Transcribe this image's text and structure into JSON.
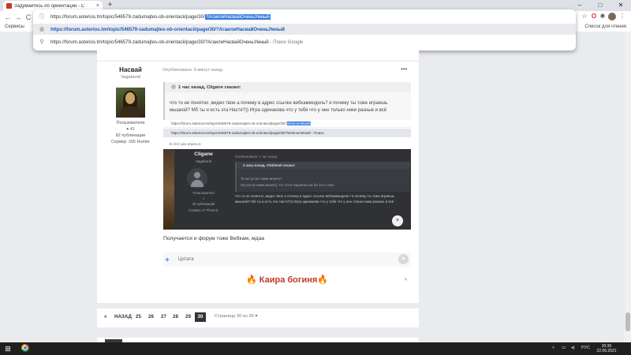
{
  "browser": {
    "tab_title": "Задумайтесь об ориентации - С",
    "tab_close": "×",
    "new_tab": "+",
    "window_min": "–",
    "window_max": "□",
    "window_close": "✕",
    "back": "←",
    "forward": "→",
    "reload": "C"
  },
  "bookmarks": {
    "left_label": "Сервисы",
    "right_label": "Список для чтения"
  },
  "omnibox": {
    "input_prefix": "https://forum.asterios.tm/topic/546579-zadumajtes-ob-orientacii/page/30/",
    "input_highlight": "?АгаилиНасвайОченьУмный",
    "suggestion_url_bold": "https://forum.asterios.tm/topic/546579-zadumajtes-ob-orientacii/page/30/?АгаилиНасвайОченьУмный",
    "suggestion_search_text": "https://forum.asterios.tm/topic/546579-zadumajtes-ob-orientacii/page/30/?АгаилиНасвайОченьУмный",
    "suggestion_search_engine": "- Поиск Google"
  },
  "author": {
    "name": "Насвай",
    "rank": "Vagabond",
    "group": "Пользователи",
    "reputation": "41",
    "posts": "82 публикации",
    "server": "Сервер: x55 Hunter"
  },
  "post": {
    "meta": "Опубликовано: 8 минут назад",
    "more": "•••",
    "quote_head": "1 час назад, Cligane сказал:",
    "quote_body": "что то не понятно ,видео твое а почему в адрес ссылке вебкаммодель? и почему ты тоже играешь мышкой? Мб ты и есть эта Настя?)) Игра одинакова что у тебя что у нее только ники разные и всё",
    "text": "Получается и форум тоже Вебкам, мдаа",
    "quote_action": "Цитата",
    "signature": "🔥 Каира богиня🔥",
    "sig_close": "✕"
  },
  "embedded": {
    "url_prefix": "https://forum.asterios.tm/topic/546579-zadumajtes-ob-orientacii/page/30/?",
    "url_highlight": "WebcamModel",
    "suggestion": "https://forum.asterios.tm/topic/546579-zadumajtes-ob-orientacii/page/30/?WebcamModel - Поиск",
    "nav": "В этот раз играть в",
    "name": "Cligane",
    "rank": "Vagabond",
    "rep": "4",
    "group": "Пользователи",
    "posts": "16 публикаций",
    "server": "Сервер: x7 Phoenix",
    "meta": "Опубликовано: 1 час назад",
    "quote_head": "2 часа назад, VinDiesel сказал:",
    "quote_line1": "Ты же устал Нами менять?",
    "quote_line2": "Ну рэп на нами канале), тот что в подписке как бы есть тоже.",
    "text": "что то не понятно ,видео твое а почему в адрес ссылке вебкаммодель? и почему ты тоже играешь мышкой? Мб ты и есть эта Настя?)) Игра одинакова что у тебя что у нее только ники разные и всё"
  },
  "pagination": {
    "prev_arrow": "«",
    "back": "НАЗАД",
    "pages": [
      "25",
      "26",
      "27",
      "28",
      "29"
    ],
    "current": "30",
    "info": "Страница 30 из 30 ▾"
  },
  "taskbar": {
    "lang": "РУС",
    "time": "20:35",
    "date": "22.06.2021"
  }
}
